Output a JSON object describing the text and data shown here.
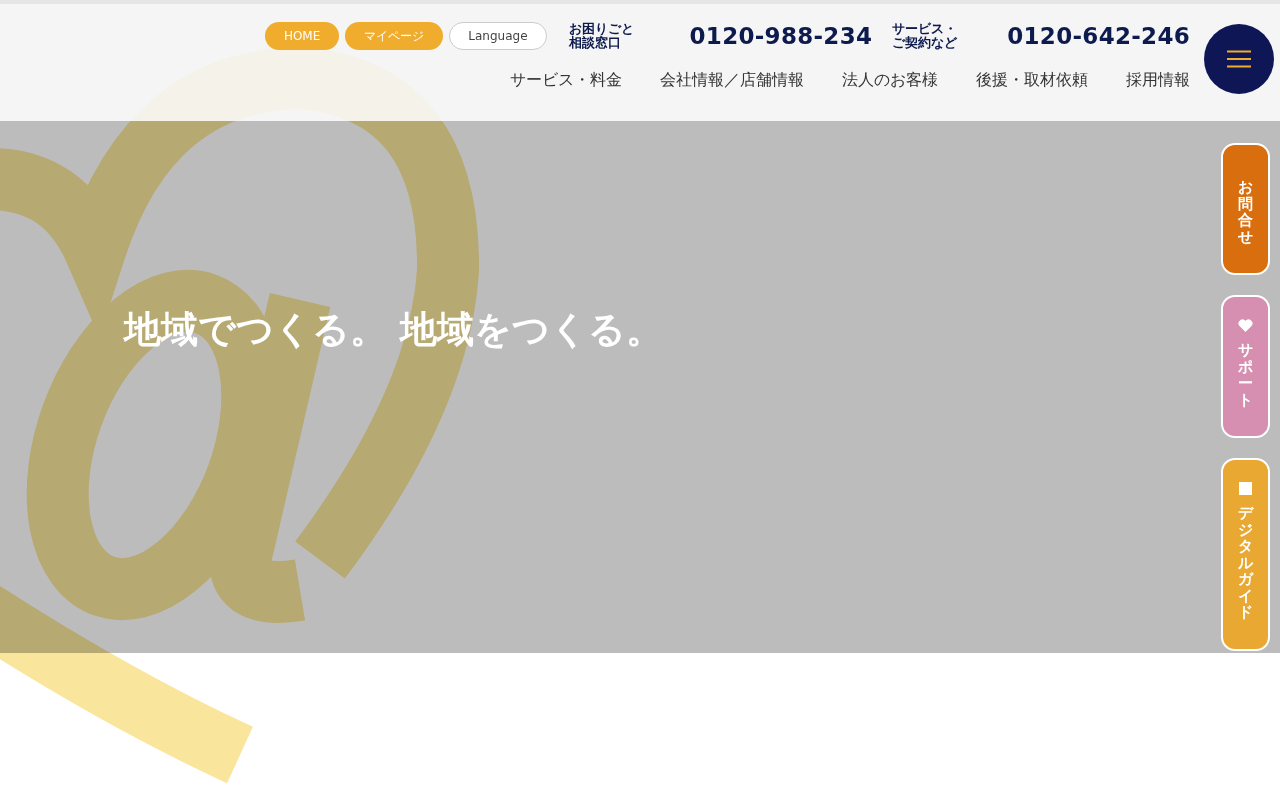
{
  "header": {
    "buttons": [
      {
        "label": "HOME",
        "kind": "filled"
      },
      {
        "label": "マイページ",
        "kind": "filled"
      },
      {
        "label": "Language",
        "kind": "outline"
      }
    ],
    "contacts": [
      {
        "label_lines": [
          "お困りごと",
          "相談窓口"
        ],
        "phone": "0120-988-234"
      },
      {
        "label_lines": [
          "サービス・",
          "ご契約など"
        ],
        "phone": "0120-642-246"
      }
    ],
    "nav": [
      "サービス・料金",
      "会社情報／店舗情報",
      "法人のお客様",
      "後援・取材依頼",
      "採用情報"
    ]
  },
  "hero": {
    "tagline": "地域でつくる。 地域をつくる。"
  },
  "side_tabs": [
    {
      "label": "お問合せ",
      "kind": "plain",
      "color": "#d96e0e"
    },
    {
      "label": "サポート",
      "kind": "heart",
      "color": "#d68fb0"
    },
    {
      "label": "デジタルガイド",
      "kind": "square",
      "color": "#e8a832"
    }
  ]
}
